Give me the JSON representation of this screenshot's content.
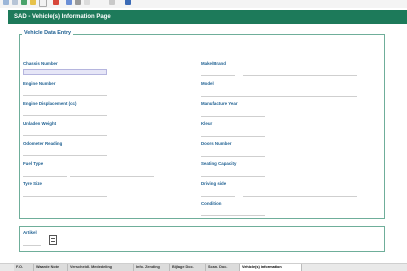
{
  "toolbar": {
    "icons": [
      "back-icon",
      "forward-icon",
      "stop-icon",
      "refresh-icon",
      "home-icon",
      "search-icon",
      "favorites-icon",
      "print-icon",
      "mail-icon",
      "edit-icon",
      "settings-icon"
    ]
  },
  "header": {
    "title": "SAD - Vehicle(s) Information Page"
  },
  "form": {
    "legend": "Vehicle Data Entry",
    "left_fields": [
      "Chassis Number",
      "Engine Number",
      "Engine Displacement (cc)",
      "Unladen Weight",
      "Odometer Reading",
      "Fuel Type",
      "Tyre Size"
    ],
    "right_fields": [
      "Make/Brand",
      "Model",
      "Manufacture Year",
      "Kleur",
      "Doors Number",
      "Seating Capacity",
      "Driving side",
      "Condition"
    ]
  },
  "artikel": {
    "label": "Artikel"
  },
  "tabs": [
    "F.O.",
    "Waarde Note",
    "Verscheidl. Mededeling",
    "Info. Zending",
    "Bijlage Doc.",
    "Scan. Doc.",
    "Vehicle(s) information"
  ],
  "colors": {
    "title_bar": "#1d7a5a",
    "label": "#1d5f91",
    "border": "#6fae9a"
  }
}
